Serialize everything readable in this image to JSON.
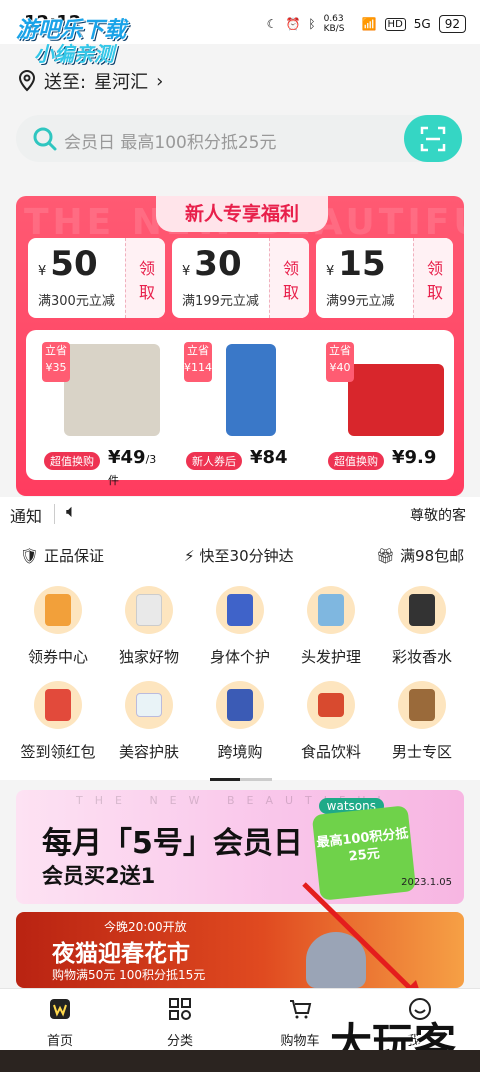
{
  "status_bar": {
    "time": "12:12",
    "net_speed": "0.63 KB/S",
    "hd": "HD",
    "signal": "5G",
    "battery": "92"
  },
  "watermark_top": {
    "line1": "游吧乐下载",
    "line2": "小编亲测"
  },
  "address": {
    "prefix": "送至:",
    "location": "星河汇"
  },
  "search": {
    "placeholder": "会员日 最高100积分抵25元"
  },
  "new_user": {
    "bg_text": "THE NEW BEAUTIFUL",
    "title": "新人专享福利",
    "coupons": [
      {
        "currency": "¥",
        "amount": "50",
        "condition": "满300元立减",
        "action": "领取"
      },
      {
        "currency": "¥",
        "amount": "30",
        "condition": "满199元立减",
        "action": "领取"
      },
      {
        "currency": "¥",
        "amount": "15",
        "condition": "满99元立减",
        "action": "领取"
      }
    ],
    "products": [
      {
        "save_label": "立省",
        "save_amount": "¥35",
        "badge": "超值换购",
        "price": "¥49",
        "unit": "/3件",
        "color": "#d9d3c7"
      },
      {
        "save_label": "立省",
        "save_amount": "¥114",
        "badge": "新人券后",
        "price": "¥84",
        "unit": "",
        "color": "#3a78c8"
      },
      {
        "save_label": "立省",
        "save_amount": "¥40",
        "badge": "超值换购",
        "price": "¥9.9",
        "unit": "",
        "color": "#d8262c"
      }
    ]
  },
  "notice": {
    "label": "通知",
    "text": "尊敬的客"
  },
  "perks": [
    "正品保证",
    "快至30分钟达",
    "满98包邮"
  ],
  "categories": [
    {
      "name": "领券中心",
      "color": "#f2a03a"
    },
    {
      "name": "独家好物",
      "color": "#e9e9e9"
    },
    {
      "name": "身体个护",
      "color": "#3f63c9"
    },
    {
      "name": "头发护理",
      "color": "#7fb7e0"
    },
    {
      "name": "彩妆香水",
      "color": "#333333"
    },
    {
      "name": "签到领红包",
      "color": "#e24a3b"
    },
    {
      "name": "美容护肤",
      "color": "#e9f3f7"
    },
    {
      "name": "跨境购",
      "color": "#3b5bb5"
    },
    {
      "name": "食品饮料",
      "color": "#d84a2f"
    },
    {
      "name": "男士专区",
      "color": "#9a6a3a"
    }
  ],
  "banner1": {
    "bg_text": "THE NEW BEAUTIFUL",
    "line1": "每月「5号」会员日",
    "line2": "会员买2送1",
    "brand": "watsons",
    "cube": "最高100积分抵25元",
    "date": "2023.1.05"
  },
  "banner2": {
    "time": "今晚20:00开放",
    "title": "夜猫迎春花市",
    "sub": "购物满50元 100积分抵15元"
  },
  "tabs": [
    "首页",
    "分类",
    "购物车",
    "我的"
  ],
  "watermark_bottom": "大玩客"
}
